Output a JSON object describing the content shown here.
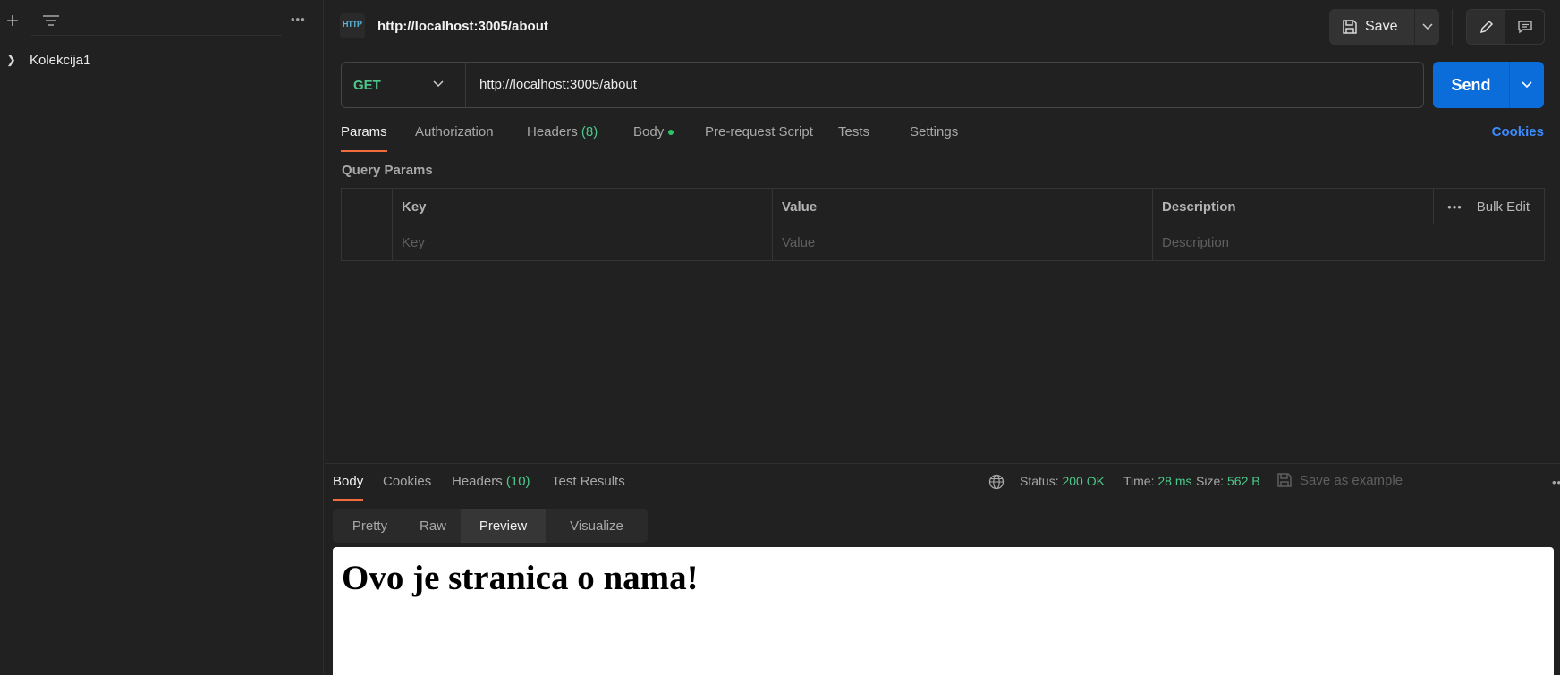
{
  "sidebar": {
    "more_label": "•••",
    "items": [
      {
        "label": "Kolekcija1"
      }
    ]
  },
  "request": {
    "title": "http://localhost:3005/about",
    "icon_label": "HTTP",
    "save_label": "Save",
    "method": "GET",
    "url": "http://localhost:3005/about",
    "send_label": "Send"
  },
  "request_tabs": {
    "params": "Params",
    "authorization": "Authorization",
    "headers": "Headers",
    "headers_count": "(8)",
    "body": "Body",
    "prerequest": "Pre-request Script",
    "tests": "Tests",
    "settings": "Settings",
    "cookies": "Cookies"
  },
  "query_params": {
    "title": "Query Params",
    "columns": {
      "key": "Key",
      "value": "Value",
      "description": "Description"
    },
    "bulk_edit": "Bulk Edit",
    "more_label": "•••",
    "placeholders": {
      "key": "Key",
      "value": "Value",
      "description": "Description"
    }
  },
  "response": {
    "tabs": {
      "body": "Body",
      "cookies": "Cookies",
      "headers": "Headers",
      "headers_count": "(10)",
      "test_results": "Test Results"
    },
    "status_label": "Status:",
    "status_value": "200 OK",
    "time_label": "Time:",
    "time_value": "28 ms",
    "size_label": "Size:",
    "size_value": "562 B",
    "save_example": "Save as example",
    "more_label": "•••",
    "views": [
      "Pretty",
      "Raw",
      "Preview",
      "Visualize"
    ],
    "active_view": "Preview",
    "preview_heading": "Ovo je stranica o nama!"
  },
  "colors": {
    "background": "#212121",
    "accent_orange": "#f26b3a",
    "send_blue": "#0b6dd9",
    "method_green": "#4cc98a",
    "cookies_link": "#3b8cff"
  }
}
